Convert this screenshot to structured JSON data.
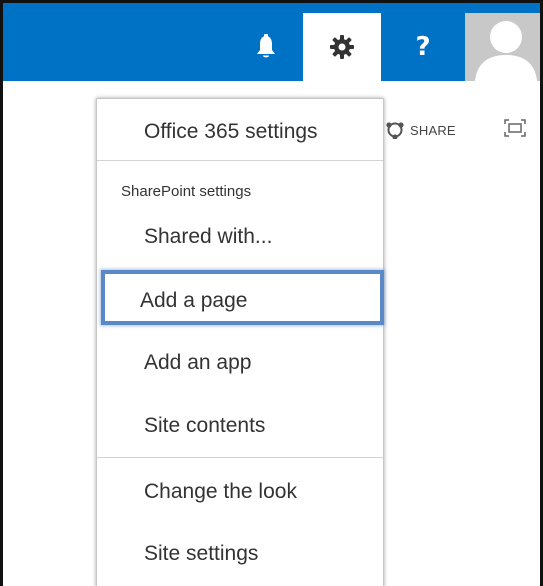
{
  "suitebar": {
    "bell_icon": "bell-icon",
    "gear_icon": "gear-icon",
    "help_label": "?",
    "avatar_icon": "person-icon",
    "accent_color": "#0072c6"
  },
  "ribbon": {
    "share_label": "SHARE",
    "share_icon": "share-icon",
    "focus_icon": "focus-on-content-icon"
  },
  "menu": {
    "office_settings": "Office 365 settings",
    "sharepoint_heading": "SharePoint settings",
    "items": [
      {
        "label": "Shared with..."
      },
      {
        "label": "Add a page"
      },
      {
        "label": "Add an app"
      },
      {
        "label": "Site contents"
      },
      {
        "label": "Change the look"
      },
      {
        "label": "Site settings"
      }
    ],
    "highlight_color": "#5b88c6"
  }
}
